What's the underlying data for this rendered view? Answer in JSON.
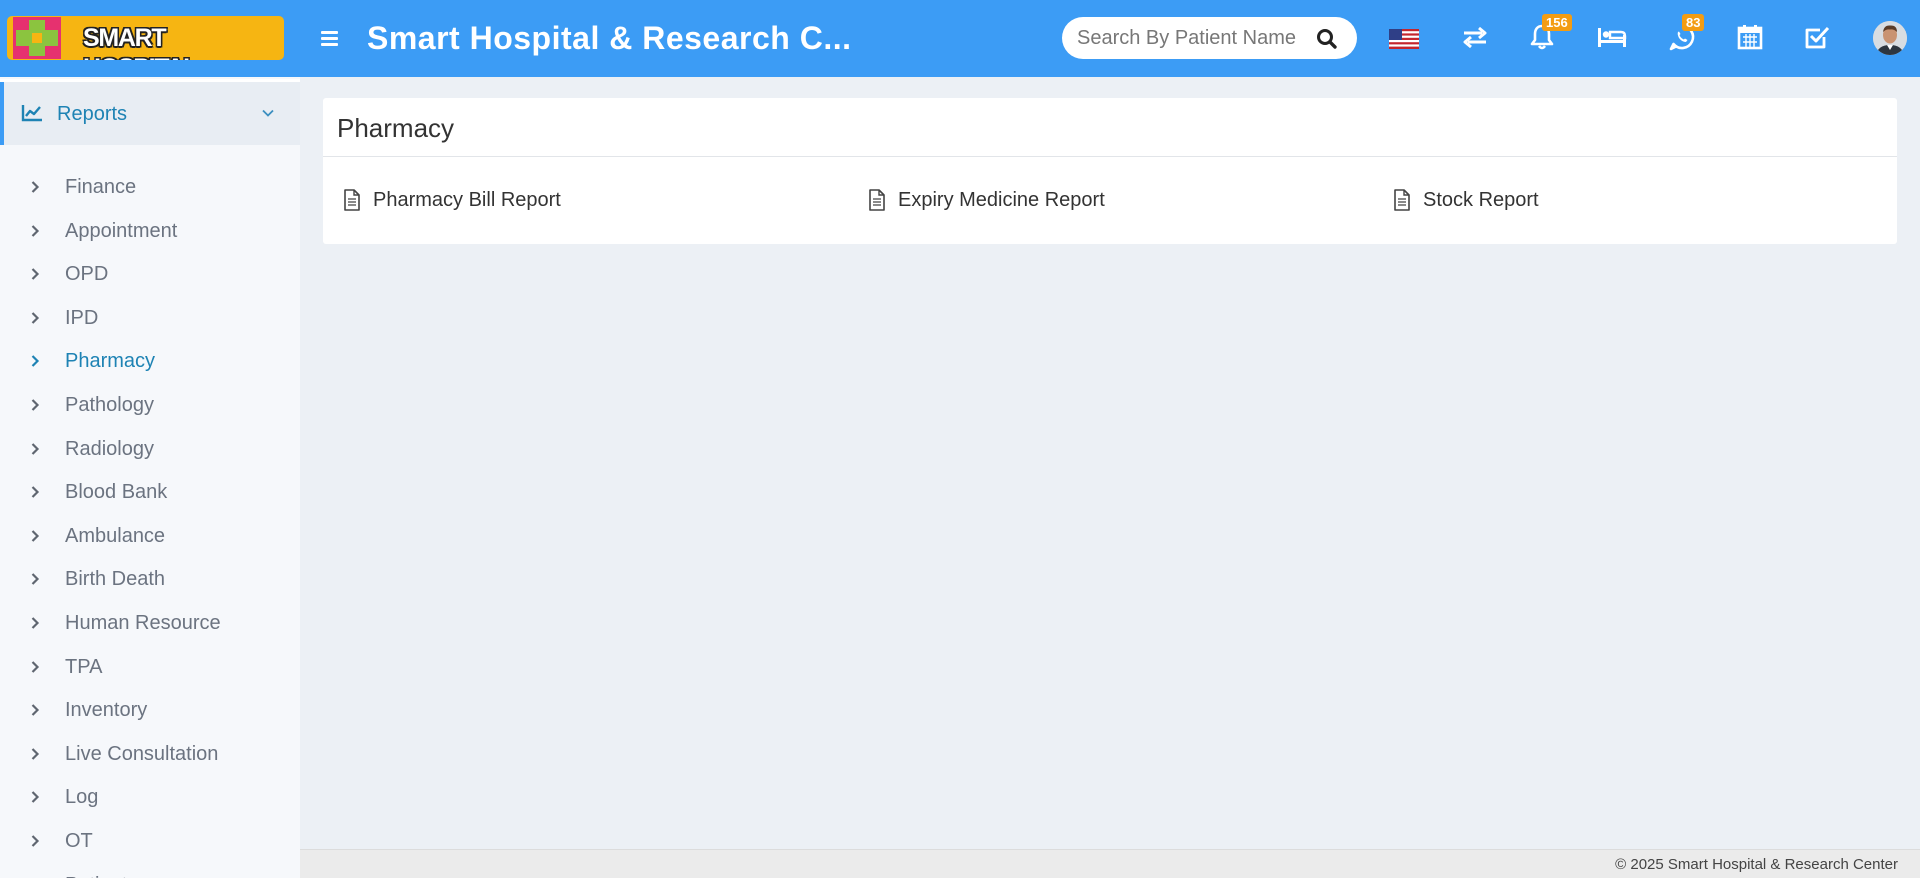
{
  "header": {
    "logo_text": "SMART HOSPITAL",
    "app_title": "Smart Hospital & Research C...",
    "search": {
      "placeholder": "Search By Patient Name"
    },
    "icons": [
      {
        "name": "us-flag-icon"
      },
      {
        "name": "swap-arrows-icon"
      },
      {
        "name": "bell-icon",
        "badge": "156"
      },
      {
        "name": "bed-icon"
      },
      {
        "name": "whatsapp-icon",
        "badge": "83"
      },
      {
        "name": "calendar-icon"
      },
      {
        "name": "task-checkbox-icon"
      },
      {
        "name": "user-avatar"
      }
    ]
  },
  "sidebar": {
    "section": "Reports",
    "items": [
      {
        "label": "Finance"
      },
      {
        "label": "Appointment"
      },
      {
        "label": "OPD"
      },
      {
        "label": "IPD"
      },
      {
        "label": "Pharmacy",
        "active": true
      },
      {
        "label": "Pathology"
      },
      {
        "label": "Radiology"
      },
      {
        "label": "Blood Bank"
      },
      {
        "label": "Ambulance"
      },
      {
        "label": "Birth Death"
      },
      {
        "label": "Human Resource"
      },
      {
        "label": "TPA"
      },
      {
        "label": "Inventory"
      },
      {
        "label": "Live Consultation"
      },
      {
        "label": "Log"
      },
      {
        "label": "OT"
      },
      {
        "label": "Patient"
      }
    ]
  },
  "main": {
    "title": "Pharmacy",
    "reports": [
      {
        "label": "Pharmacy Bill Report"
      },
      {
        "label": "Expiry Medicine Report"
      },
      {
        "label": "Stock Report"
      }
    ]
  },
  "footer": {
    "text": "© 2025 Smart Hospital & Research Center"
  },
  "colors": {
    "header_bg": "#3c9cf5",
    "logo_bg": "#f6b512",
    "badge_bg": "#f39c12",
    "active_text": "#1e83b4",
    "page_bg": "#ecf0f5"
  }
}
